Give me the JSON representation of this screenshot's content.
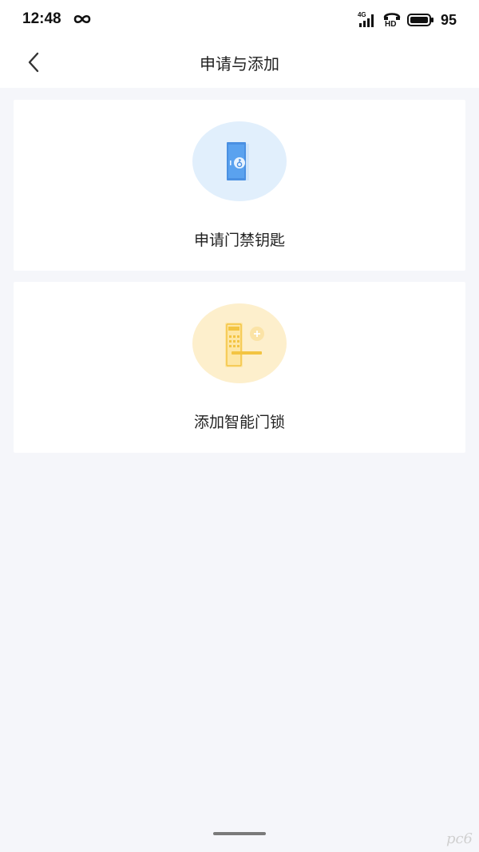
{
  "status_bar": {
    "time": "12:48",
    "network": "4G",
    "hd_label": "HD",
    "battery": "95"
  },
  "header": {
    "title": "申请与添加",
    "back_icon": "chevron-left-icon"
  },
  "cards": [
    {
      "label": "申请门禁钥匙",
      "icon": "door-key-icon",
      "circle_color": "#e1effc"
    },
    {
      "label": "添加智能门锁",
      "icon": "smart-lock-add-icon",
      "circle_color": "#fdefcc"
    }
  ],
  "watermark": "pc6"
}
